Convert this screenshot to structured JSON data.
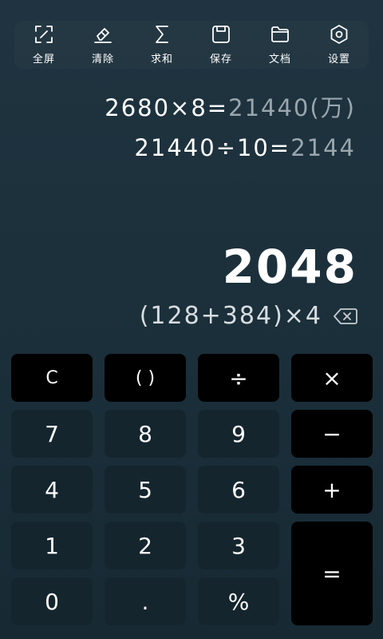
{
  "toolbar": {
    "items": [
      {
        "label": "全屏",
        "icon": "fullscreen-icon"
      },
      {
        "label": "清除",
        "icon": "eraser-icon"
      },
      {
        "label": "求和",
        "icon": "sigma-icon"
      },
      {
        "label": "保存",
        "icon": "save-icon"
      },
      {
        "label": "文档",
        "icon": "folder-icon"
      },
      {
        "label": "设置",
        "icon": "settings-icon"
      }
    ]
  },
  "history": [
    {
      "expression": "2680×8=",
      "result": "21440(万)"
    },
    {
      "expression": "21440÷10=",
      "result": "2144"
    }
  ],
  "display": {
    "result": "2048",
    "expression": "(128+384)×4"
  },
  "keys": {
    "clear": "C",
    "parens": "( )",
    "divide": "÷",
    "multiply": "×",
    "seven": "7",
    "eight": "8",
    "nine": "9",
    "minus": "−",
    "four": "4",
    "five": "5",
    "six": "6",
    "plus": "+",
    "one": "1",
    "two": "2",
    "three": "3",
    "equals": "=",
    "zero": "0",
    "decimal": ".",
    "percent": "%"
  },
  "colors": {
    "background": "#1e333e",
    "key": "#15252e",
    "operator_key": "#000000",
    "history_result": "#9aa6ae"
  }
}
